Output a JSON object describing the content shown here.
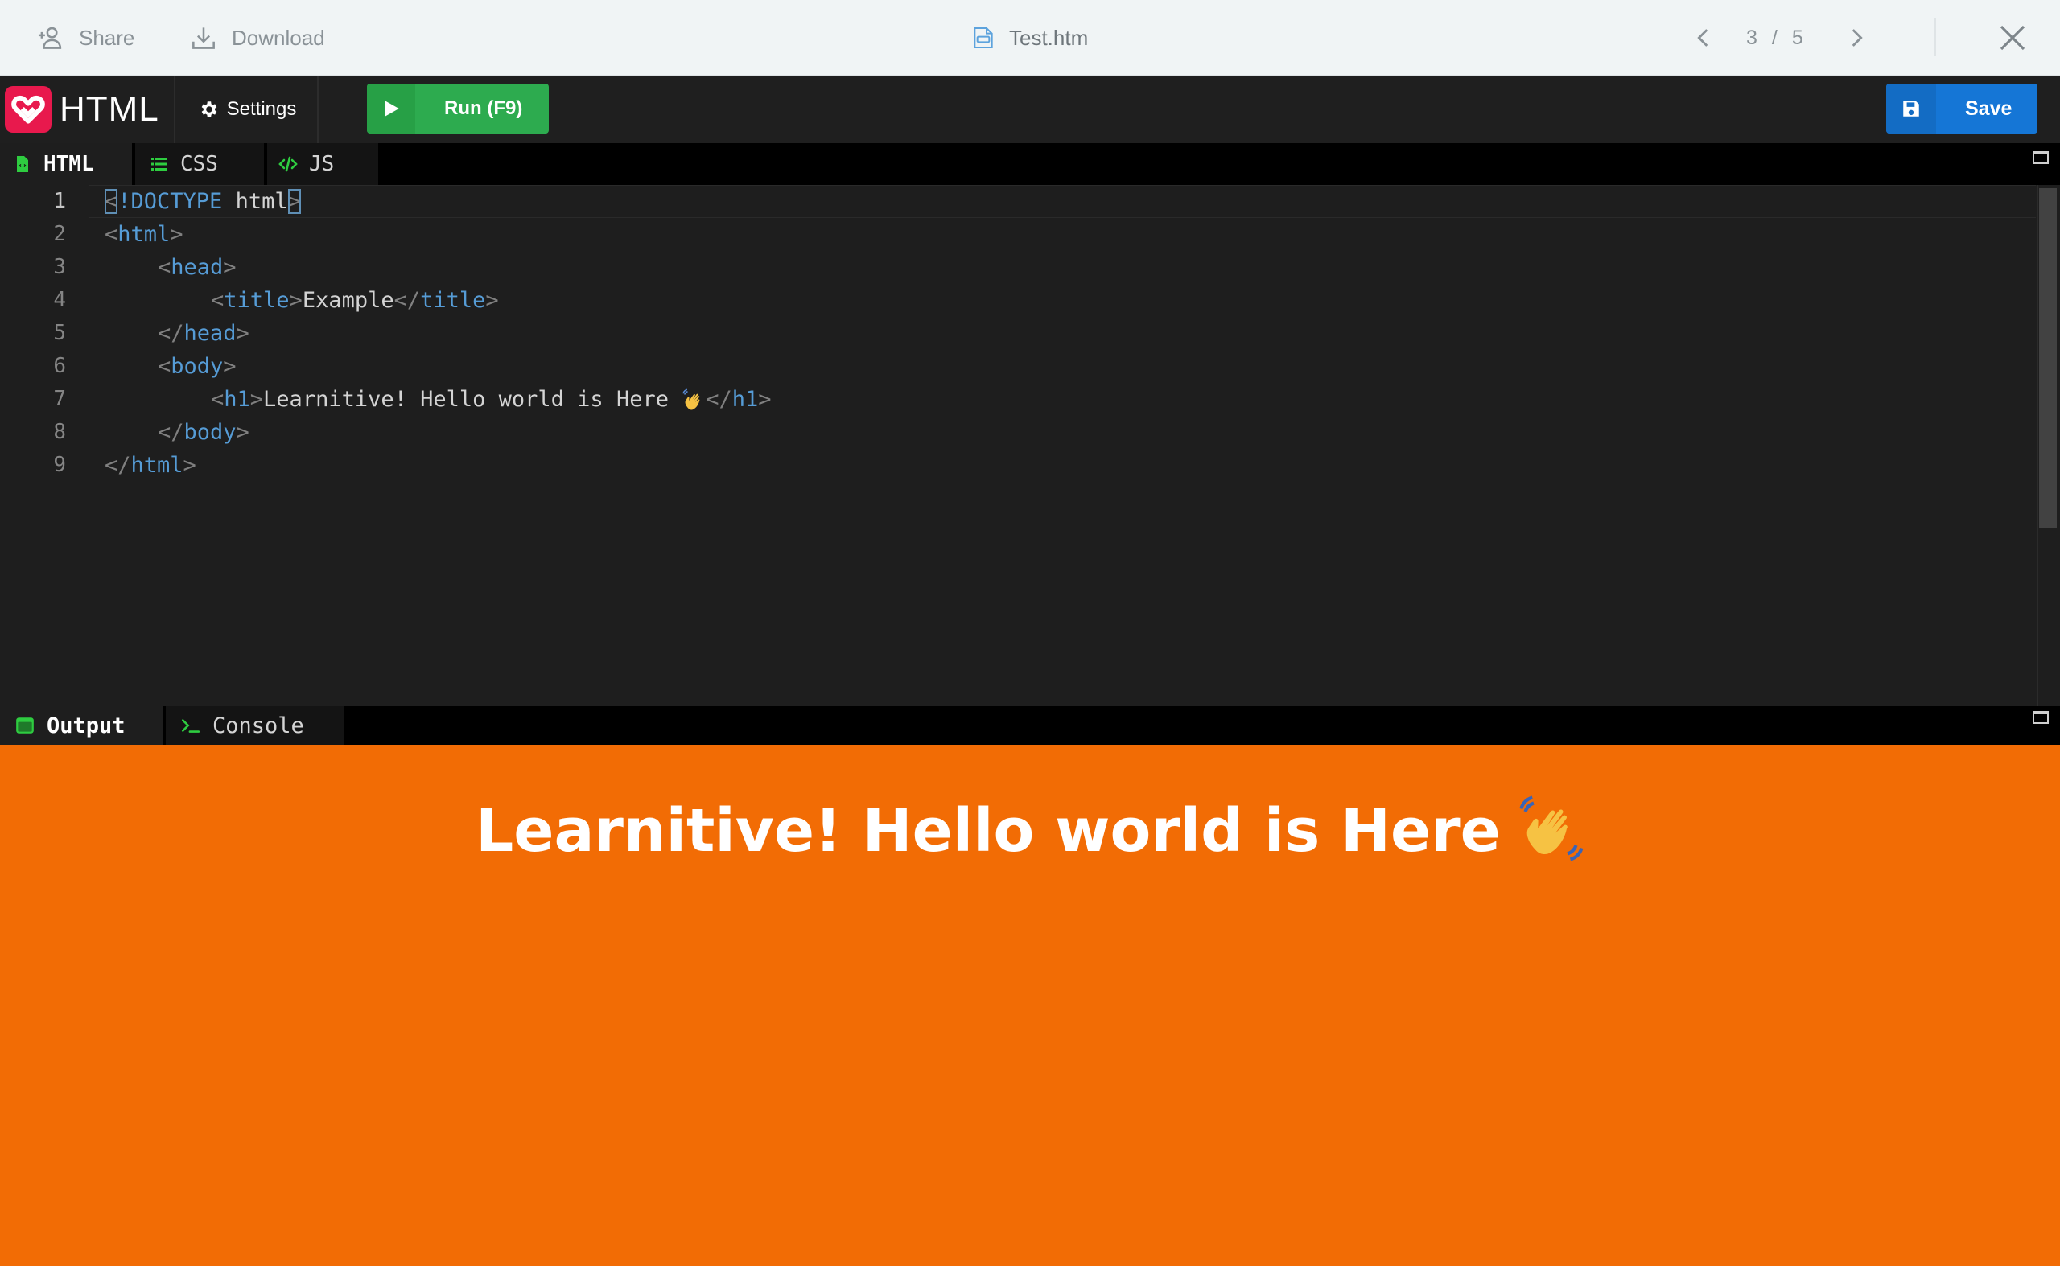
{
  "viewer": {
    "share_label": "Share",
    "download_label": "Download",
    "file_name": "Test.htm",
    "page_current": "3",
    "page_separator": "/",
    "page_total": "5"
  },
  "toolbar": {
    "logo_text": "HTML",
    "settings_label": "Settings",
    "run_label": "Run (F9)",
    "save_label": "Save"
  },
  "code_tabs": [
    {
      "label": "HTML",
      "active": true
    },
    {
      "label": "CSS",
      "active": false
    },
    {
      "label": "JS",
      "active": false
    }
  ],
  "editor": {
    "line_numbers": [
      "1",
      "2",
      "3",
      "4",
      "5",
      "6",
      "7",
      "8",
      "9"
    ],
    "lines": [
      {
        "lt": "<",
        "bang": "!DOCTYPE",
        "sp": " ",
        "word": "html",
        "gt": ">"
      },
      {
        "open": "<",
        "tag": "html",
        "close": ">"
      },
      {
        "open": "<",
        "tag": "head",
        "close": ">"
      },
      {
        "open": "<",
        "tag": "title",
        "close": ">",
        "text": "Example",
        "open2": "</",
        "tag2": "title",
        "close2": ">"
      },
      {
        "open": "</",
        "tag": "head",
        "close": ">"
      },
      {
        "open": "<",
        "tag": "body",
        "close": ">"
      },
      {
        "open": "<",
        "tag": "h1",
        "close": ">",
        "text": "Learnitive! Hello world is Here ",
        "open2": "</",
        "tag2": "h1",
        "close2": ">"
      },
      {
        "open": "</",
        "tag": "body",
        "close": ">"
      },
      {
        "open": "</",
        "tag": "html",
        "close": ">"
      }
    ]
  },
  "output_tabs": [
    {
      "label": "Output",
      "active": true
    },
    {
      "label": "Console",
      "active": false
    }
  ],
  "preview": {
    "heading": "Learnitive! Hello world is Here",
    "background": "#f26c05"
  },
  "colors": {
    "run_green": "#2dab4f",
    "save_blue": "#1576d6",
    "logo_red": "#e8194d",
    "tag_blue": "#569cd6"
  }
}
